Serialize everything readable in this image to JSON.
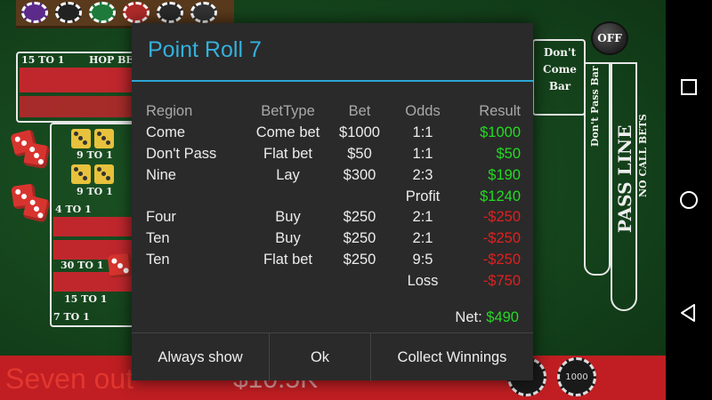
{
  "table": {
    "odds_label_15": "15 TO 1",
    "hop_bets_label": "HOP BE",
    "odds_9_to_1_a": "9 TO 1",
    "odds_9_to_1_b": "9 TO 1",
    "odds_4_to_1": "4 TO 1",
    "odds_30_to_1": "30 TO 1",
    "odds_15_to_1_b": "15 TO 1",
    "odds_7_to_1": "7 TO 1",
    "dont_come_bar": [
      "Don't",
      "Come",
      "Bar"
    ],
    "dont_pass_bar": "Don't Pass Bar",
    "pass_line": "PASS LINE",
    "no_call_bets": "NO CALL BETS",
    "puck_label": "OFF",
    "status_text": "Seven out",
    "balance_text": "$10.5K",
    "bottom_chip_label": "1000"
  },
  "dialog": {
    "title": "Point Roll 7",
    "headers": {
      "region": "Region",
      "bettype": "BetType",
      "bet": "Bet",
      "odds": "Odds",
      "result": "Result"
    },
    "rows": [
      {
        "region": "Come",
        "bettype": "Come bet",
        "bet": "$1000",
        "odds": "1:1",
        "result": "$1000"
      },
      {
        "region": "Don't Pass",
        "bettype": "Flat bet",
        "bet": "$50",
        "odds": "1:1",
        "result": "$50"
      },
      {
        "region": "Nine",
        "bettype": "Lay",
        "bet": "$300",
        "odds": "2:3",
        "result": "$190"
      },
      {
        "region": "",
        "bettype": "",
        "bet": "",
        "odds": "Profit",
        "result": "$1240"
      },
      {
        "region": "Four",
        "bettype": "Buy",
        "bet": "$250",
        "odds": "2:1",
        "result": "-$250"
      },
      {
        "region": "Ten",
        "bettype": "Buy",
        "bet": "$250",
        "odds": "2:1",
        "result": "-$250"
      },
      {
        "region": "Ten",
        "bettype": "Flat bet",
        "bet": "$250",
        "odds": "9:5",
        "result": "-$250"
      },
      {
        "region": "",
        "bettype": "",
        "bet": "",
        "odds": "Loss",
        "result": "-$750"
      }
    ],
    "net_label": "Net:",
    "net_value": "$490",
    "buttons": {
      "always_show": "Always show",
      "ok": "Ok",
      "collect": "Collect Winnings"
    },
    "colors": {
      "title": "#35b0dc",
      "positive": "#22dc22",
      "negative": "#e02020",
      "rule": "#2ba7d4"
    }
  },
  "navbar": {
    "icons": [
      "recents-square-icon",
      "home-circle-icon",
      "back-triangle-icon"
    ]
  }
}
